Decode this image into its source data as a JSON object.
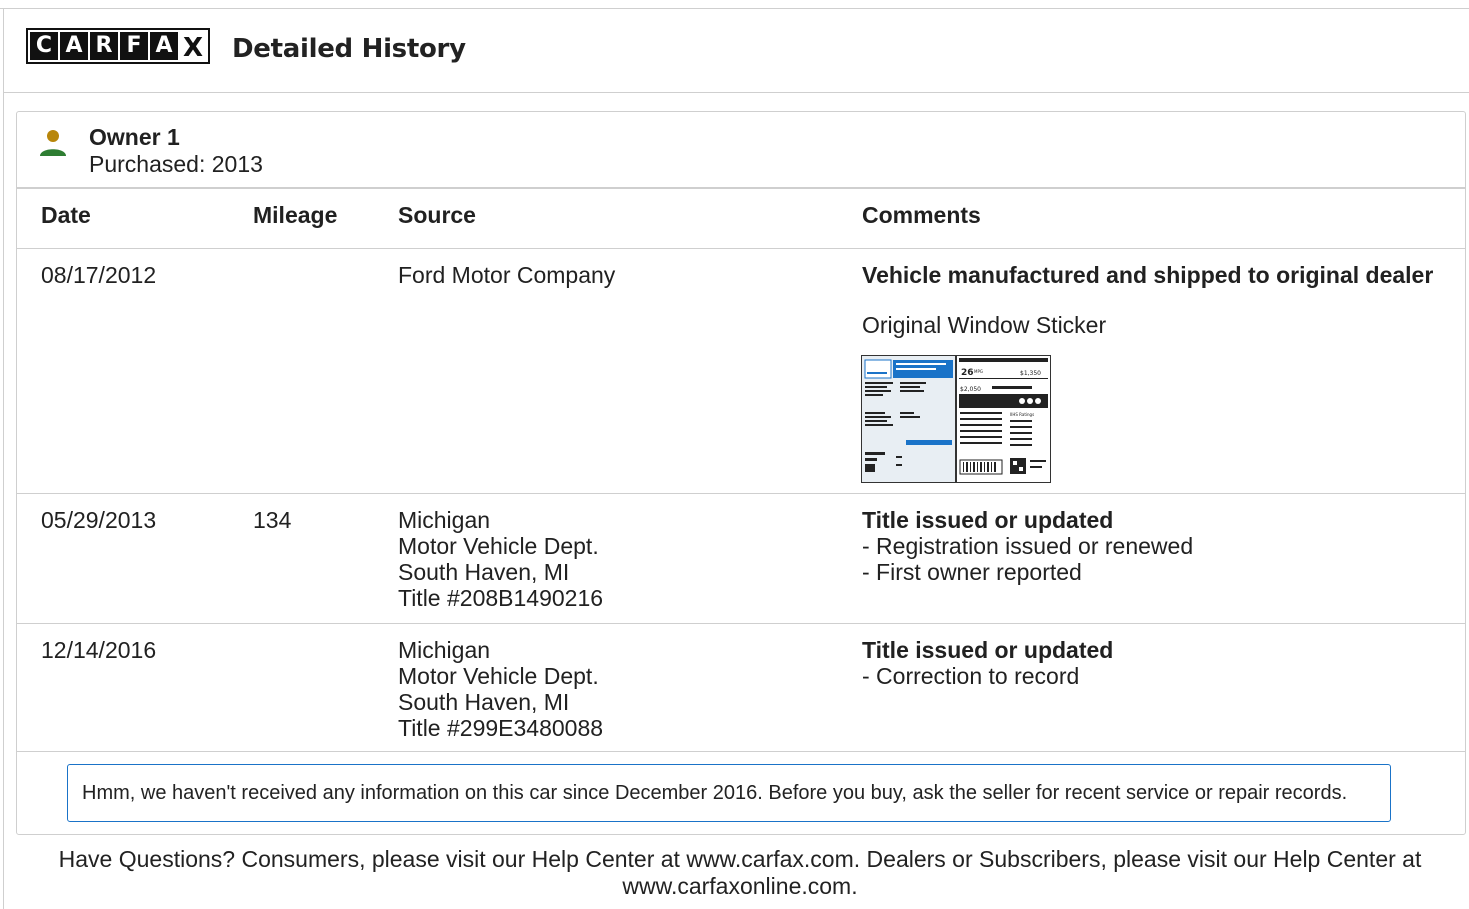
{
  "header": {
    "logo_letters": [
      "C",
      "A",
      "R",
      "F",
      "A",
      "X"
    ],
    "logo_alt": "CARFAX",
    "title": "Detailed History"
  },
  "owner": {
    "icon": "person-icon",
    "icon_colors": {
      "head": "#b8860b",
      "body": "#2e7d32"
    },
    "name": "Owner 1",
    "purchased": "Purchased: 2013"
  },
  "table": {
    "columns": [
      "Date",
      "Mileage",
      "Source",
      "Comments"
    ],
    "rows": [
      {
        "date": "08/17/2012",
        "mileage": "",
        "source": [
          "Ford Motor Company"
        ],
        "comment_title": "Vehicle manufactured and shipped to original dealer",
        "comment_items": [],
        "extra": "Original Window Sticker"
      },
      {
        "date": "05/29/2013",
        "mileage": "134",
        "source": [
          "Michigan",
          "Motor Vehicle Dept.",
          "South Haven, MI",
          "Title #208B1490216"
        ],
        "comment_title": "Title issued or updated",
        "comment_items": [
          "- Registration issued or renewed",
          "- First owner reported"
        ]
      },
      {
        "date": "12/14/2016",
        "mileage": "",
        "source": [
          "Michigan",
          "Motor Vehicle Dept.",
          "South Haven, MI",
          "Title #299E3480088"
        ],
        "comment_title": "Title issued or updated",
        "comment_items": [
          "- Correction to record"
        ]
      }
    ]
  },
  "sticker": {
    "mpg": "26",
    "mpg_unit": "MPG",
    "price_1": "$1,350",
    "price_2": "$2,050",
    "ratings_label": "IIHS Ratings"
  },
  "notice": "Hmm, we haven't received any information on this car since December 2016. Before you buy, ask the seller for recent service or repair records.",
  "footer": "Have Questions? Consumers, please visit our Help Center at www.carfax.com. Dealers or Subscribers, please visit our Help Center at www.carfaxonline.com.",
  "colors": {
    "accent_blue": "#1a73c8",
    "border": "#cfcfcf",
    "text": "#212121"
  }
}
